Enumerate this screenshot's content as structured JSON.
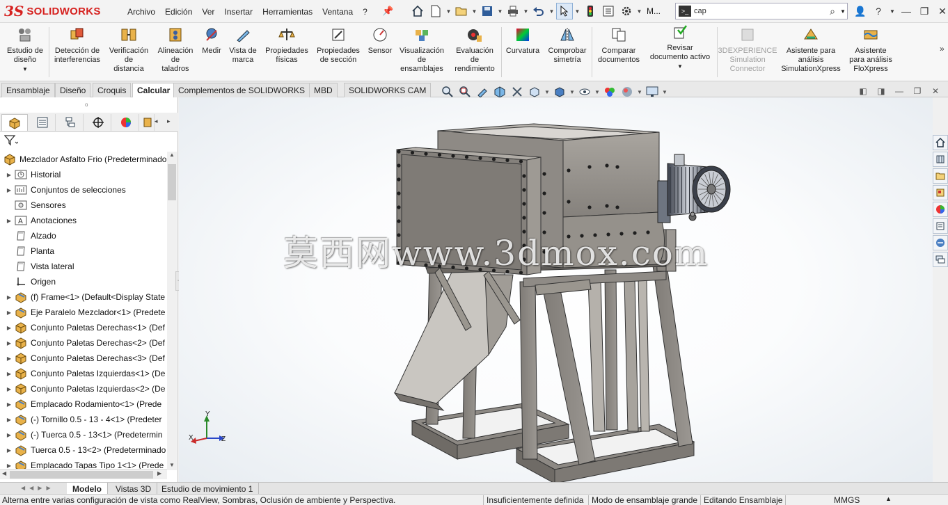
{
  "app": {
    "logo_ds": "3S",
    "logo_text": "SOLIDWORKS"
  },
  "menus": [
    "Archivo",
    "Edición",
    "Ver",
    "Insertar",
    "Herramientas",
    "Ventana",
    "?"
  ],
  "quick_access": {
    "m_label": "M..."
  },
  "search": {
    "value": "cap"
  },
  "ribbon": {
    "buttons": [
      {
        "label": "Estudio de\ndiseño",
        "icon": "design-study-icon"
      },
      {
        "label": "Detección de\ninterferencias",
        "icon": "interference-detection-icon"
      },
      {
        "label": "Verificación\nde\ndistancia",
        "icon": "clearance-verification-icon"
      },
      {
        "label": "Alineación\nde\ntaladros",
        "icon": "hole-alignment-icon"
      },
      {
        "label": "Medir",
        "icon": "measure-icon"
      },
      {
        "label": "Vista de\nmarca",
        "icon": "markup-icon"
      },
      {
        "label": "Propiedades\nfísicas",
        "icon": "mass-properties-icon"
      },
      {
        "label": "Propiedades\nde sección",
        "icon": "section-properties-icon"
      },
      {
        "label": "Sensor",
        "icon": "sensor-icon"
      },
      {
        "label": "Visualización\nde\nensamblajes",
        "icon": "assembly-visualization-icon"
      },
      {
        "label": "Evaluación\nde\nrendimiento",
        "icon": "performance-evaluation-icon"
      },
      {
        "label": "Curvatura",
        "icon": "curvature-icon"
      },
      {
        "label": "Comprobar\nsimetría",
        "icon": "symmetry-check-icon"
      },
      {
        "label": "Comparar\ndocumentos",
        "icon": "compare-documents-icon"
      },
      {
        "label": "Revisar\ndocumento activo",
        "icon": "check-active-document-icon"
      },
      {
        "label": "3DEXPERIENCE\nSimulation\nConnector",
        "icon": "3dexperience-icon"
      },
      {
        "label": "Asistente para\nanálisis\nSimulationXpress",
        "icon": "simulationxpress-icon"
      },
      {
        "label": "Asistente\npara análisis\nFloXpress",
        "icon": "floxpress-icon"
      }
    ]
  },
  "command_tabs": [
    "Ensamblaje",
    "Diseño",
    "Croquis",
    "Calcular",
    "Complementos de SOLIDWORKS",
    "MBD",
    "SOLIDWORKS CAM"
  ],
  "active_command_tab": "Calcular",
  "feature_tree": {
    "root": "Mezclador Asfalto Frio  (Predeterminado",
    "items": [
      {
        "label": "Historial",
        "icon": "history-folder-icon",
        "expandable": true
      },
      {
        "label": "Conjuntos de selecciones",
        "icon": "selection-sets-icon",
        "expandable": true
      },
      {
        "label": "Sensores",
        "icon": "sensors-folder-icon",
        "expandable": false
      },
      {
        "label": "Anotaciones",
        "icon": "annotations-icon",
        "expandable": true
      },
      {
        "label": "Alzado",
        "icon": "plane-icon",
        "expandable": false
      },
      {
        "label": "Planta",
        "icon": "plane-icon",
        "expandable": false
      },
      {
        "label": "Vista lateral",
        "icon": "plane-icon",
        "expandable": false
      },
      {
        "label": "Origen",
        "icon": "origin-icon",
        "expandable": false
      },
      {
        "label": "(f) Frame<1> (Default<Display State",
        "icon": "part-icon",
        "expandable": true
      },
      {
        "label": "Eje Paralelo Mezclador<1> (Predete",
        "icon": "part-icon",
        "expandable": true
      },
      {
        "label": "Conjunto Paletas Derechas<1> (Def",
        "icon": "subassembly-icon",
        "expandable": true
      },
      {
        "label": "Conjunto Paletas Derechas<2> (Def",
        "icon": "subassembly-icon",
        "expandable": true
      },
      {
        "label": "Conjunto Paletas Derechas<3> (Def",
        "icon": "subassembly-icon",
        "expandable": true
      },
      {
        "label": "Conjunto Paletas Izquierdas<1> (De",
        "icon": "subassembly-icon",
        "expandable": true
      },
      {
        "label": "Conjunto Paletas Izquierdas<2> (De",
        "icon": "subassembly-icon",
        "expandable": true
      },
      {
        "label": "Emplacado Rodamiento<1> (Prede",
        "icon": "part-icon",
        "expandable": true
      },
      {
        "label": "(-) Tornillo 0.5 - 13 - 4<1> (Predeter",
        "icon": "part-icon",
        "expandable": true
      },
      {
        "label": "(-) Tuerca 0.5 - 13<1> (Predetermin",
        "icon": "part-icon",
        "expandable": true
      },
      {
        "label": "Tuerca 0.5 - 13<2> (Predeterminado",
        "icon": "part-icon",
        "expandable": true
      },
      {
        "label": "Emplacado Tapas Tipo 1<1> (Prede",
        "icon": "part-icon",
        "expandable": true
      }
    ]
  },
  "viewport": {
    "watermark": "莫西网www.3dmox.com",
    "triad": {
      "x": "X",
      "y": "Y",
      "z": "Z"
    }
  },
  "bottom_tabs": [
    "Modelo",
    "Vistas 3D",
    "Estudio de movimiento 1"
  ],
  "status": {
    "hint": "Alterna entre varias configuración de vista como RealView, Sombras, Oclusión de ambiente y Perspectiva.",
    "definition": "Insuficientemente definida",
    "mode": "Modo de ensamblaje grande",
    "editing": "Editando Ensamblaje",
    "units": "MMGS"
  },
  "colors": {
    "brand_red": "#d6211f",
    "steel": "#8e8a85",
    "viewport_bg": "#f7f9fb"
  }
}
